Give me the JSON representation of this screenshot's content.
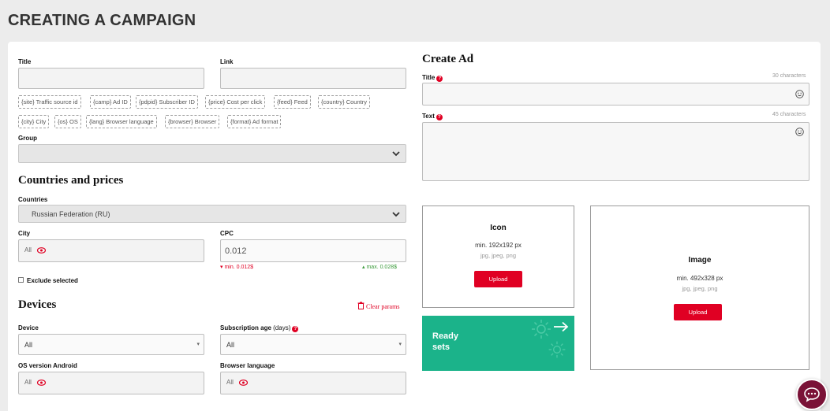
{
  "page": {
    "title": "CREATING A CAMPAIGN"
  },
  "form": {
    "title_label": "Title",
    "link_label": "Link",
    "macros": [
      "{site} Traffic source id",
      "{camp} Ad ID",
      "{pdpid} Subscriber ID",
      "{price} Cost per click",
      "{feed} Feed",
      "{country} Country",
      "{city} City",
      "{os} OS",
      "{lang} Browser language",
      "{browser} Browser",
      "{format} Ad format"
    ],
    "group_label": "Group"
  },
  "countries": {
    "heading": "Countries and prices",
    "countries_label": "Countries",
    "countries_value": "Russian Federation (RU)",
    "city_label": "City",
    "city_value": "All",
    "cpc_label": "CPC",
    "cpc_value": "0.012",
    "min_text": "min. 0.012$",
    "max_text": "max. 0.028$",
    "exclude_label": "Exclude selected"
  },
  "devices": {
    "heading": "Devices",
    "clear_label": "Clear params",
    "device_label": "Device",
    "device_value": "All",
    "sub_age_label": "Subscription age",
    "sub_age_unit": "(days)",
    "sub_age_value": "All",
    "os_label": "OS version Android",
    "os_value": "All",
    "lang_label": "Browser language",
    "lang_value": "All"
  },
  "ad": {
    "heading": "Create Ad",
    "title_label": "Title",
    "title_limit": "30 characters",
    "text_label": "Text",
    "text_limit": "45 characters",
    "icon": {
      "title": "Icon",
      "min": "min. 192x192 px",
      "formats": "jpg, jpeg, png",
      "button": "Upload"
    },
    "image": {
      "title": "Image",
      "min": "min. 492x328 px",
      "formats": "jpg, jpeg, png",
      "button": "Upload"
    },
    "ready_sets": "Ready sets"
  },
  "colors": {
    "accent_red": "#e00023",
    "ready_green": "#1bb38a",
    "chat_bg": "#7a1237"
  },
  "icons": [
    "chevron-down-icon",
    "eye-toggle-icon",
    "question-icon",
    "trash-icon",
    "smiley-icon",
    "arrow-right-icon",
    "gear-icon",
    "chat-icon"
  ]
}
